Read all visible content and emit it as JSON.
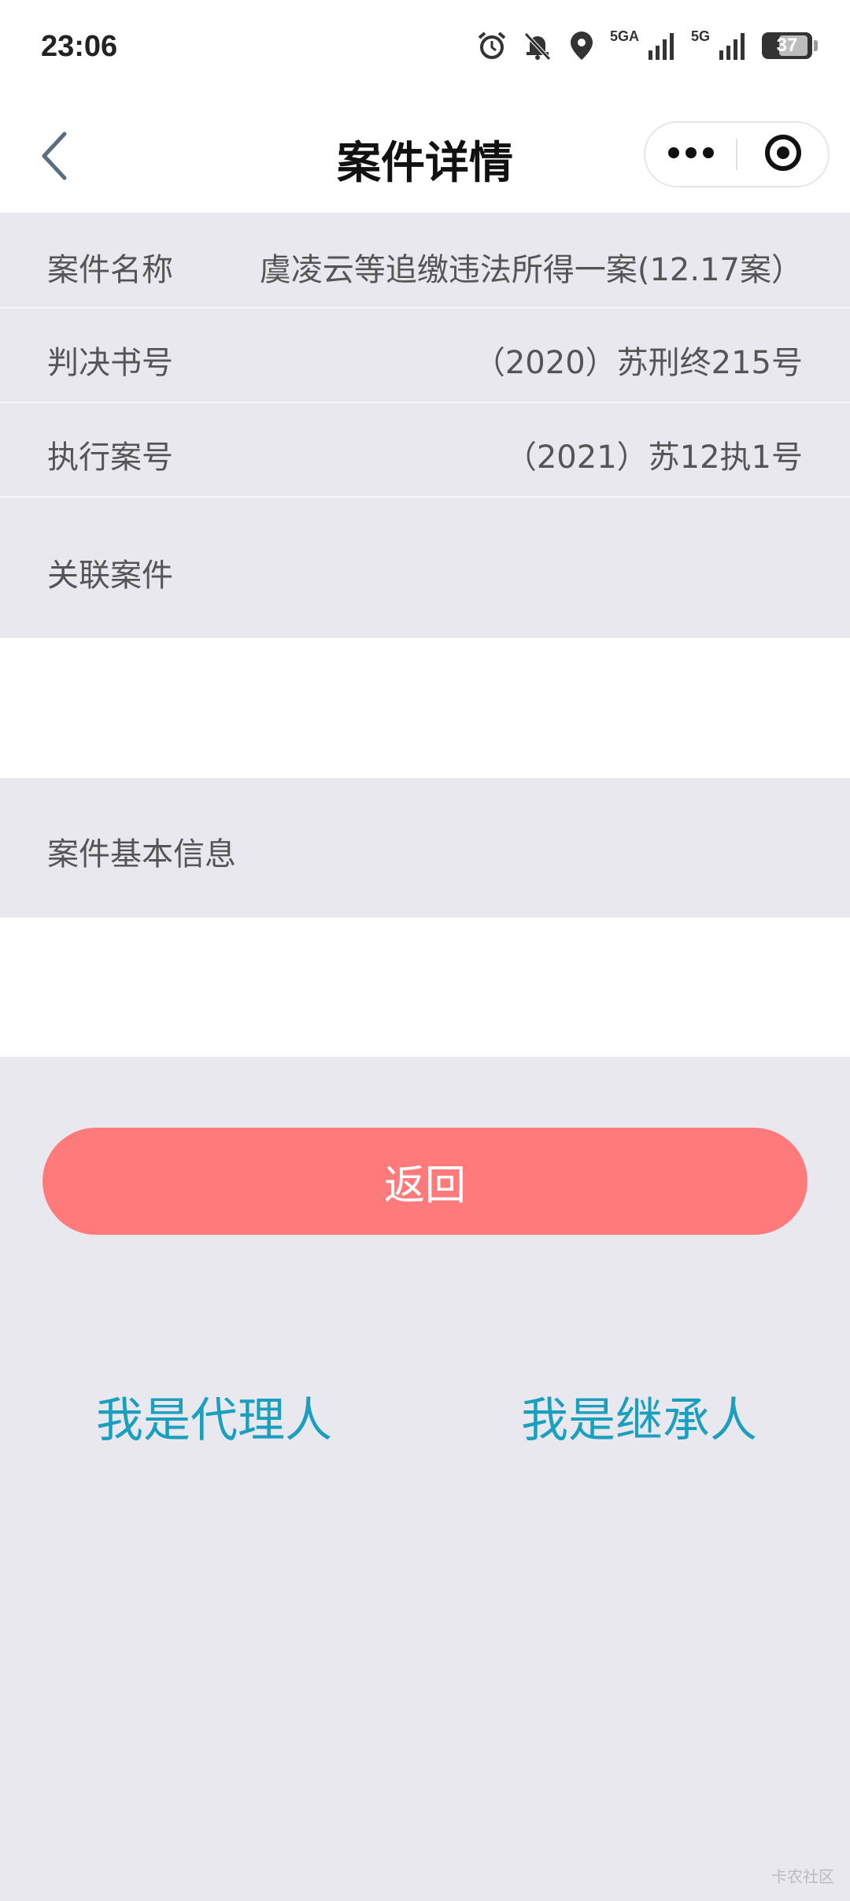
{
  "status_bar": {
    "time": "23:06",
    "network_1": "5GA",
    "network_2": "5G",
    "battery": "37",
    "icons": [
      "alarm-icon",
      "bell-off-icon",
      "location-icon",
      "signal-icon",
      "signal-icon",
      "battery-icon"
    ]
  },
  "nav": {
    "title": "案件详情",
    "back_icon": "chevron-left-icon",
    "more_icon": "more-dots-icon",
    "close_icon": "target-circle-icon"
  },
  "case": {
    "name_label": "案件名称",
    "name_value": "虞凌云等追缴违法所得一案(12.17案）",
    "judgment_label": "判决书号",
    "judgment_value": "（2020）苏刑终215号",
    "execution_label": "执行案号",
    "execution_value": "（2021）苏12执1号",
    "related_label": "关联案件",
    "basic_info_label": "案件基本信息"
  },
  "actions": {
    "return_label": "返回",
    "agent_label": "我是代理人",
    "heir_label": "我是继承人"
  },
  "watermark": "卡农社区",
  "colors": {
    "return_button": "#ff7b7b",
    "role_link": "#1a9fbf",
    "page_background": "#e9e8ee"
  }
}
